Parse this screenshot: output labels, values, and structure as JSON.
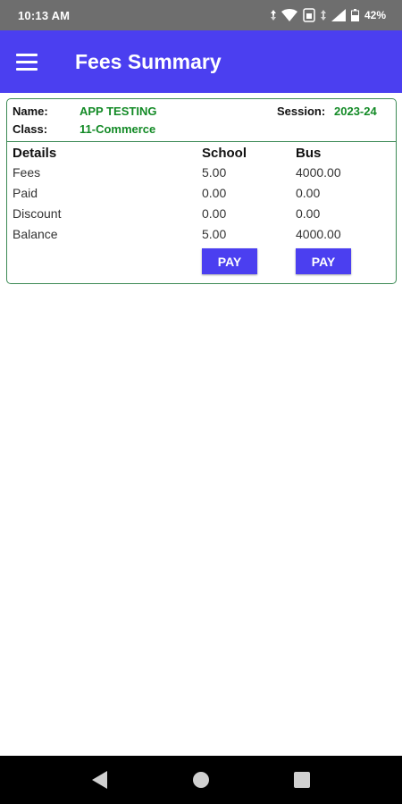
{
  "status_bar": {
    "time": "10:13 AM",
    "battery": "42%",
    "icons": [
      "data-arrows-icon",
      "wifi-icon",
      "sim-icon",
      "signal-icon",
      "battery-icon"
    ]
  },
  "app_bar": {
    "title": "Fees Summary",
    "menu_icon": "hamburger-menu-icon"
  },
  "student": {
    "name_label": "Name:",
    "name": "APP TESTING",
    "class_label": "Class:",
    "class": "11-Commerce",
    "session_label": "Session:",
    "session": "2023-24"
  },
  "fees_table": {
    "headers": [
      "Details",
      "School",
      "Bus"
    ],
    "rows": [
      {
        "label": "Fees",
        "school": "5.00",
        "bus": "4000.00"
      },
      {
        "label": "Paid",
        "school": "0.00",
        "bus": "0.00"
      },
      {
        "label": "Discount",
        "school": "0.00",
        "bus": "0.00"
      },
      {
        "label": "Balance",
        "school": "5.00",
        "bus": "4000.00"
      }
    ],
    "pay_school_label": "PAY",
    "pay_bus_label": "PAY"
  },
  "nav_bar": {
    "icons": [
      "back-icon",
      "home-icon",
      "recents-icon"
    ]
  },
  "colors": {
    "accent": "#4b3ff0",
    "value_green": "#138a26",
    "border_green": "#3c8a55",
    "status_bar": "#6e6e6e"
  }
}
